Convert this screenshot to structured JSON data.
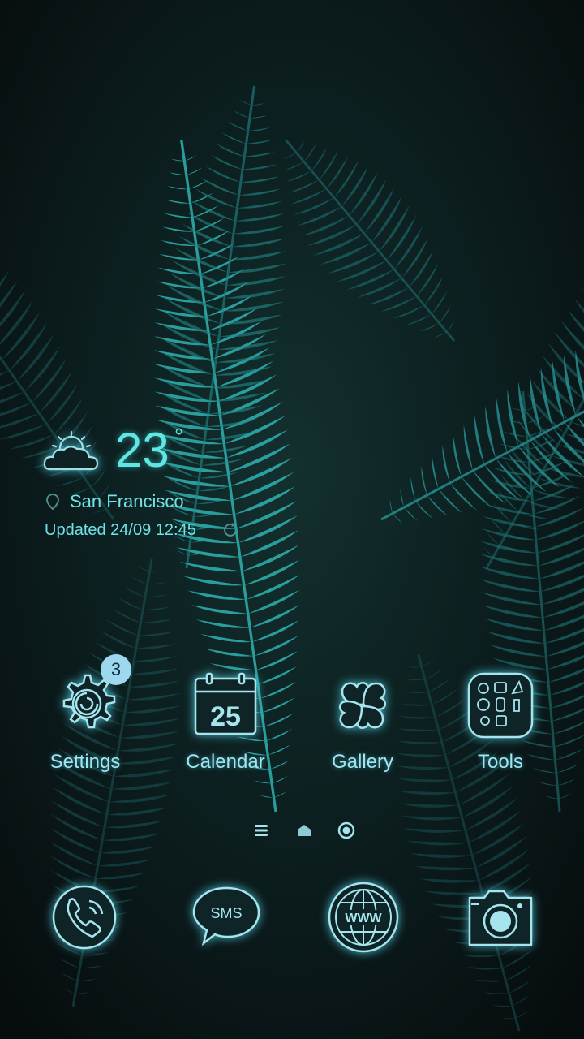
{
  "weather": {
    "temperature": "23",
    "degree_symbol": "°",
    "city": "San Francisco",
    "updated": "Updated 24/09 12:45",
    "condition_icon": "partly-cloudy-icon"
  },
  "apps": [
    {
      "label": "Settings",
      "icon": "gear-icon",
      "badge": "3"
    },
    {
      "label": "Calendar",
      "icon": "calendar-icon",
      "date_number": "25"
    },
    {
      "label": "Gallery",
      "icon": "clover-icon"
    },
    {
      "label": "Tools",
      "icon": "tools-folder-icon"
    }
  ],
  "dock": [
    {
      "icon": "phone-icon"
    },
    {
      "icon": "sms-icon",
      "text": "SMS"
    },
    {
      "icon": "browser-icon",
      "text": "WWW"
    },
    {
      "icon": "camera-icon"
    }
  ],
  "pager": [
    "menu-page-icon",
    "home-page-icon",
    "current-page-icon"
  ],
  "colors": {
    "accent": "#5ee7e5",
    "icon_glow": "#50d2e6",
    "label": "#9ee6f0"
  }
}
